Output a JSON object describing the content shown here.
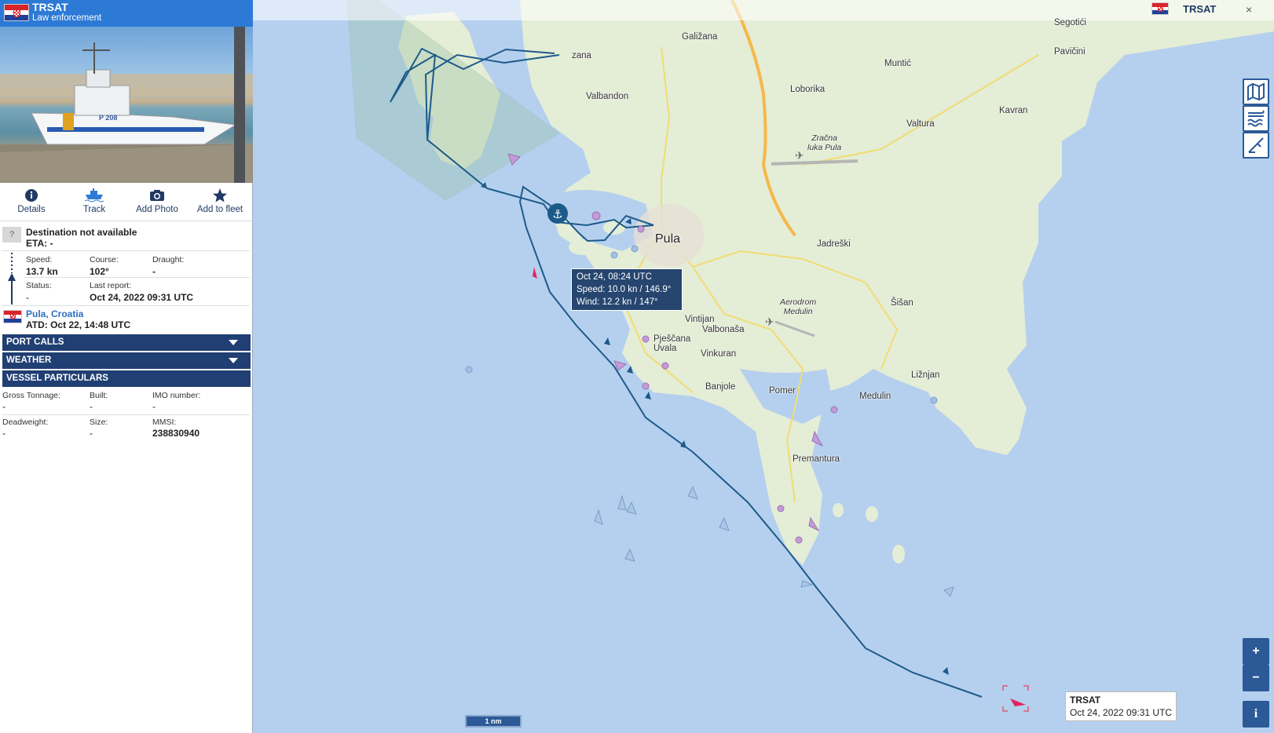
{
  "vessel": {
    "name": "TRSAT",
    "type": "Law enforcement",
    "photo_text": "P 208"
  },
  "actions": [
    {
      "label": "Details",
      "icon": "info-icon"
    },
    {
      "label": "Track",
      "icon": "ship-icon"
    },
    {
      "label": "Add Photo",
      "icon": "camera-icon"
    },
    {
      "label": "Add to fleet",
      "icon": "star-icon"
    }
  ],
  "destination": {
    "badge": "?",
    "title": "Destination not available",
    "eta": "ETA: -"
  },
  "voyage": {
    "speed_label": "Speed:",
    "speed_value": "13.7 kn",
    "course_label": "Course:",
    "course_value": "102°",
    "draught_label": "Draught:",
    "draught_value": "-",
    "status_label": "Status:",
    "status_value": "-",
    "last_report_label": "Last report:",
    "last_report_value": "Oct 24, 2022 09:31 UTC"
  },
  "departure": {
    "port": "Pula, Croatia",
    "atd": "ATD: Oct 22, 14:48 UTC"
  },
  "sections": {
    "port_calls": "PORT CALLS",
    "weather": "WEATHER",
    "particulars": "VESSEL PARTICULARS"
  },
  "particulars": {
    "gross_tonnage_label": "Gross Tonnage:",
    "gross_tonnage_value": "-",
    "built_label": "Built:",
    "built_value": "-",
    "imo_label": "IMO number:",
    "imo_value": "-",
    "deadweight_label": "Deadweight:",
    "deadweight_value": "-",
    "size_label": "Size:",
    "size_value": "-",
    "mmsi_label": "MMSI:",
    "mmsi_value": "238830940"
  },
  "map": {
    "top_vessel_name": "TRSAT",
    "close_symbol": "×",
    "places": {
      "galizana": "Galižana",
      "segotici": "Segotići",
      "pavicini": "Pavičini",
      "muntic": "Muntić",
      "loborika": "Loborika",
      "valbandon": "Valbandon",
      "valtura": "Valtura",
      "kavran": "Kavran",
      "airport_pula": "Zračna\nluka Pula",
      "pula": "Pula",
      "jadreski": "Jadreški",
      "aerodrom": "Aerodrom\nMedulin",
      "sisan": "Šišan",
      "vintijan": "Vintijan",
      "valbonasa": "Valbonaša",
      "pjescana": "Pješčana\nUvala",
      "vinkuran": "Vinkuran",
      "liznjan": "Ližnjan",
      "banjole": "Banjole",
      "pomer": "Pomer",
      "medulin": "Medulin",
      "premantura": "Premantura",
      "fazana_tail": "zana"
    },
    "tooltip": {
      "time": "Oct 24, 08:24 UTC",
      "speed": "Speed: 10.0 kn / 146.9°",
      "wind": "Wind: 12.2 kn / 147°"
    },
    "vessel_label": {
      "name": "TRSAT",
      "time": "Oct 24, 2022 09:31 UTC"
    },
    "scale": "1 nm",
    "zoom_in": "+",
    "zoom_out": "−",
    "info": "i",
    "colors": {
      "sea": "#b5d0ee",
      "land": "#e3edd8",
      "track": "#1d5a8a",
      "header": "#2c7ad6",
      "section": "#203f73"
    }
  }
}
